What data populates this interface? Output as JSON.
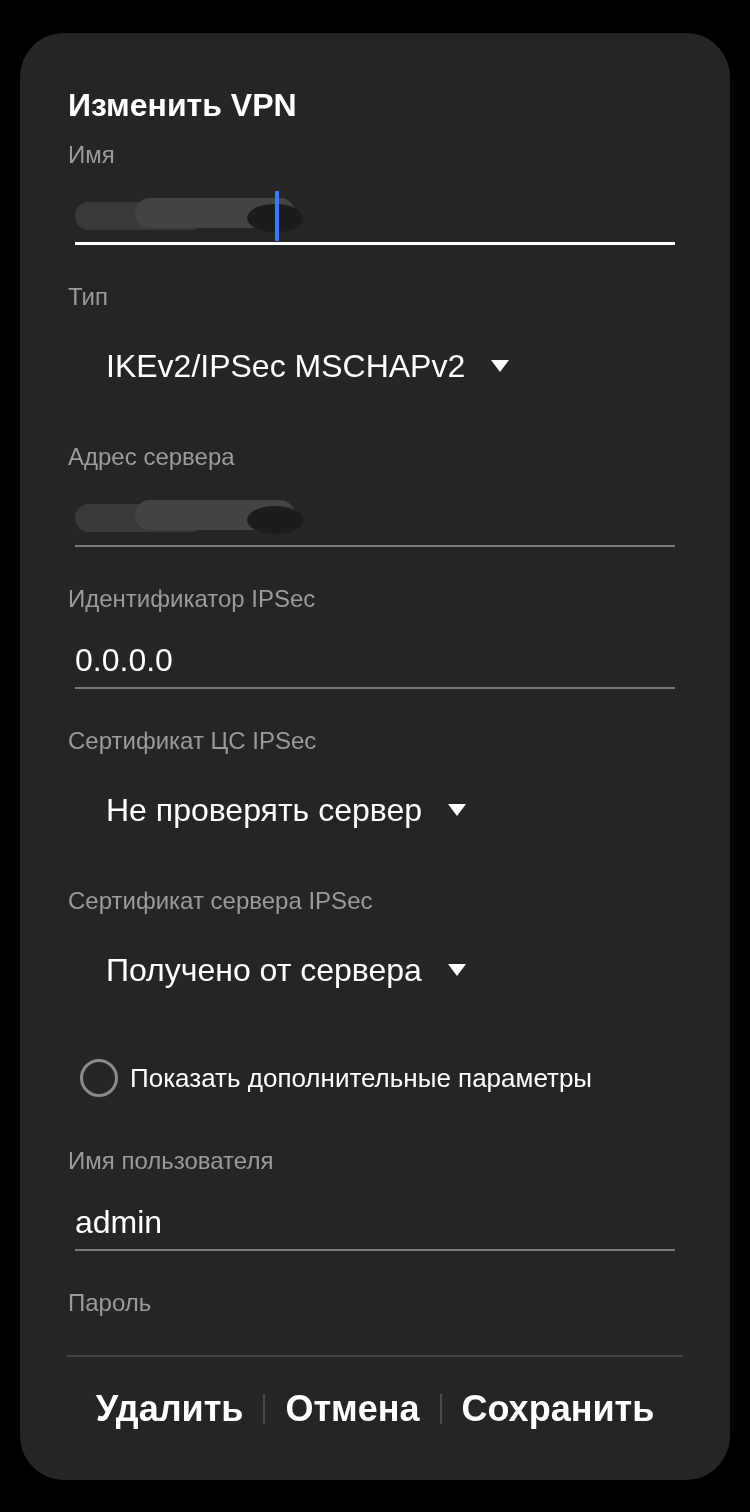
{
  "dialog": {
    "title": "Изменить VPN"
  },
  "fields": [
    {
      "kind": "text",
      "label": "Имя",
      "redacted": true,
      "focused": true
    },
    {
      "kind": "dropdown",
      "label": "Тип",
      "value": "IKEv2/IPSec MSCHAPv2"
    },
    {
      "kind": "text",
      "label": "Адрес сервера",
      "redacted": true,
      "focused": false
    },
    {
      "kind": "text",
      "label": "Идентификатор IPSec",
      "value": "0.0.0.0",
      "focused": false
    },
    {
      "kind": "dropdown",
      "label": "Сертификат ЦС IPSec",
      "value": "Не проверять сервер"
    },
    {
      "kind": "dropdown",
      "label": "Сертификат сервера IPSec",
      "value": "Получено от сервера"
    },
    {
      "kind": "checkbox",
      "label": "Показать дополнительные параметры",
      "checked": false
    },
    {
      "kind": "text",
      "label": "Имя пользователя",
      "value": "admin",
      "focused": false
    },
    {
      "kind": "password",
      "label": "Пароль"
    }
  ],
  "buttons": [
    "Удалить",
    "Отмена",
    "Сохранить"
  ]
}
